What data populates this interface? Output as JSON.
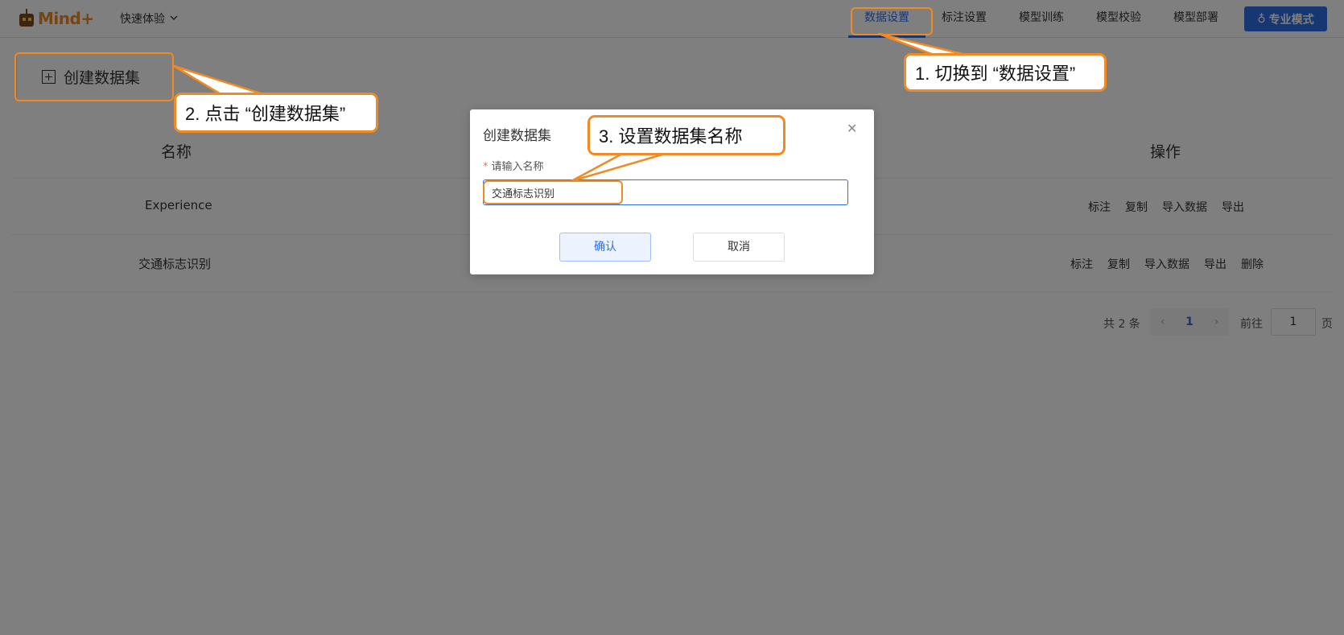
{
  "app": {
    "logo_text": "Mind+",
    "quick_menu": "快速体验"
  },
  "nav": {
    "tabs": [
      {
        "label": "数据设置",
        "active": true
      },
      {
        "label": "标注设置",
        "active": false
      },
      {
        "label": "模型训练",
        "active": false
      },
      {
        "label": "模型校验",
        "active": false
      },
      {
        "label": "模型部署",
        "active": false
      }
    ],
    "pro_mode": "专业模式",
    "pro_icon": "♁"
  },
  "toolbar": {
    "create_label": "创建数据集"
  },
  "table": {
    "headers": {
      "name": "名称",
      "ops": "操作"
    },
    "rows": [
      {
        "name": "Experience",
        "ops": [
          "标注",
          "复制",
          "导入数据",
          "导出"
        ]
      },
      {
        "name": "交通标志识别",
        "ops": [
          "标注",
          "复制",
          "导入数据",
          "导出",
          "删除"
        ]
      }
    ]
  },
  "pagination": {
    "total": "共 2 条",
    "prev": "‹",
    "current": "1",
    "next": "›",
    "goto_prefix": "前往",
    "goto_value": "1",
    "goto_suffix": "页"
  },
  "dialog": {
    "title": "创建数据集",
    "close": "✕",
    "field_required_mark": "*",
    "field_label": "请输入名称",
    "field_value": "交通标志识别",
    "confirm": "确认",
    "cancel": "取消"
  },
  "annotations": {
    "step1": "1. 切换到 “数据设置”",
    "step2": "2. 点击 “创建数据集”",
    "step3": "3. 设置数据集名称"
  },
  "colors": {
    "accent": "#2f6fe4",
    "annotation": "#f08a24",
    "overlay": "rgba(0,0,0,0.5)"
  }
}
